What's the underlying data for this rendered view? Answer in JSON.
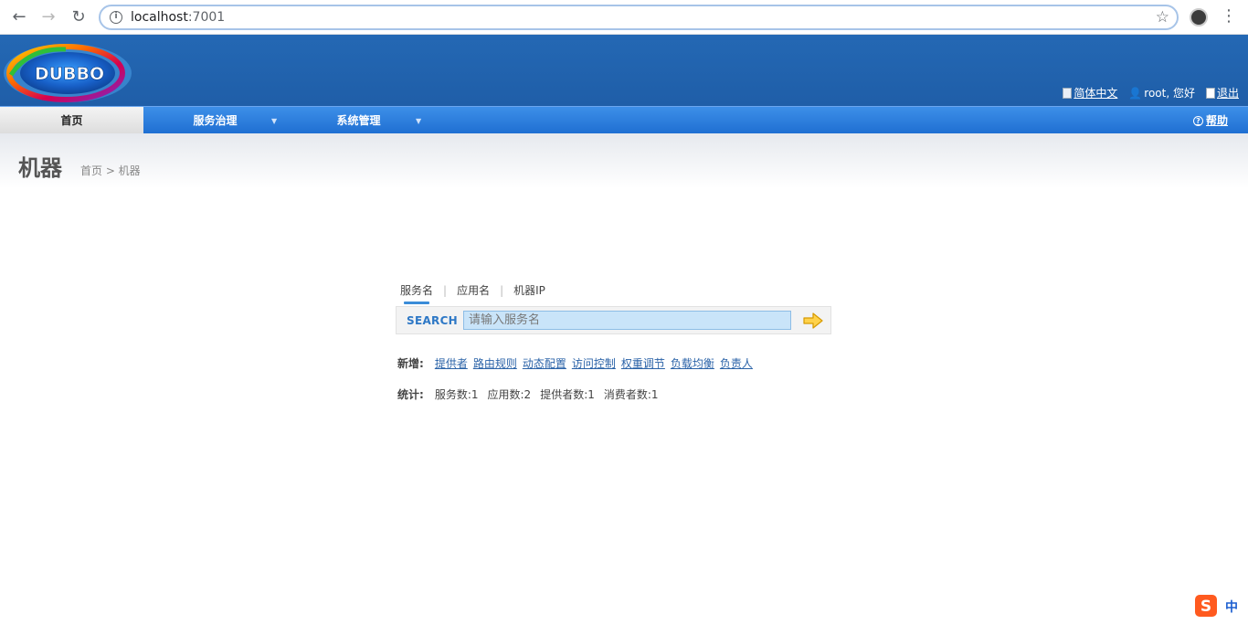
{
  "browser": {
    "url_host": "localhost",
    "url_port": ":7001"
  },
  "header": {
    "logo_text": "DUBBO",
    "language_link": "简体中文",
    "user_greeting": "root, 您好",
    "logout_link": "退出"
  },
  "mainnav": {
    "items": [
      {
        "label": "首页"
      },
      {
        "label": "服务治理"
      },
      {
        "label": "系统管理"
      }
    ],
    "help": "帮助"
  },
  "page": {
    "title": "机器",
    "breadcrumb": "首页 > 机器"
  },
  "search": {
    "tabs": [
      "服务名",
      "应用名",
      "机器IP"
    ],
    "label": "SEARCH",
    "placeholder": "请输入服务名"
  },
  "add_row": {
    "label": "新增:",
    "links": [
      "提供者",
      "路由规则",
      "动态配置",
      "访问控制",
      "权重调节",
      "负载均衡",
      "负责人"
    ]
  },
  "stats_row": {
    "label": "统计:",
    "items": [
      "服务数:1",
      "应用数:2",
      "提供者数:1",
      "消费者数:1"
    ]
  },
  "ime": {
    "mode": "中"
  },
  "colors": {
    "header_blue": "#2468b4",
    "nav_blue": "#2d80de",
    "link_blue": "#2b63a8",
    "search_label": "#2e78c6"
  }
}
